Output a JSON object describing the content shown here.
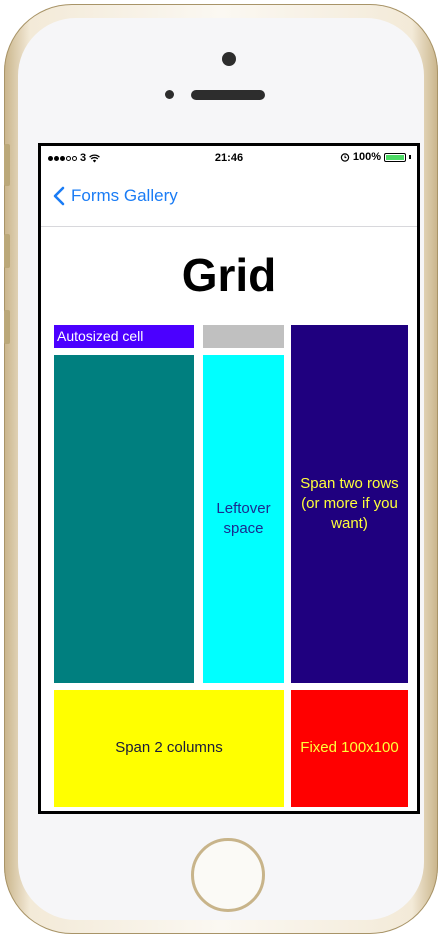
{
  "status_bar": {
    "carrier": "3",
    "time": "21:46",
    "battery_percent": "100%",
    "battery_level": 1.0
  },
  "nav": {
    "back_label": "Forms Gallery"
  },
  "page": {
    "title": "Grid"
  },
  "grid": {
    "autosized_label": "Autosized cell",
    "leftover_label": "Leftover space",
    "span_rows_label": "Span two rows (or more if you want)",
    "span_cols_label": "Span 2 columns",
    "fixed_label": "Fixed 100x100"
  },
  "colors": {
    "autosized": "#4b00ff",
    "gray": "#c0c0c0",
    "teal": "#007f7f",
    "leftover": "#00ffff",
    "span_rows": "#1f007f",
    "span_cols": "#ffff00",
    "fixed": "#ff0000",
    "ios_blue": "#1a7cf5"
  },
  "icons": {
    "back": "chevron-left-icon",
    "wifi": "wifi-icon",
    "alarm": "alarm-icon",
    "battery": "battery-icon"
  }
}
